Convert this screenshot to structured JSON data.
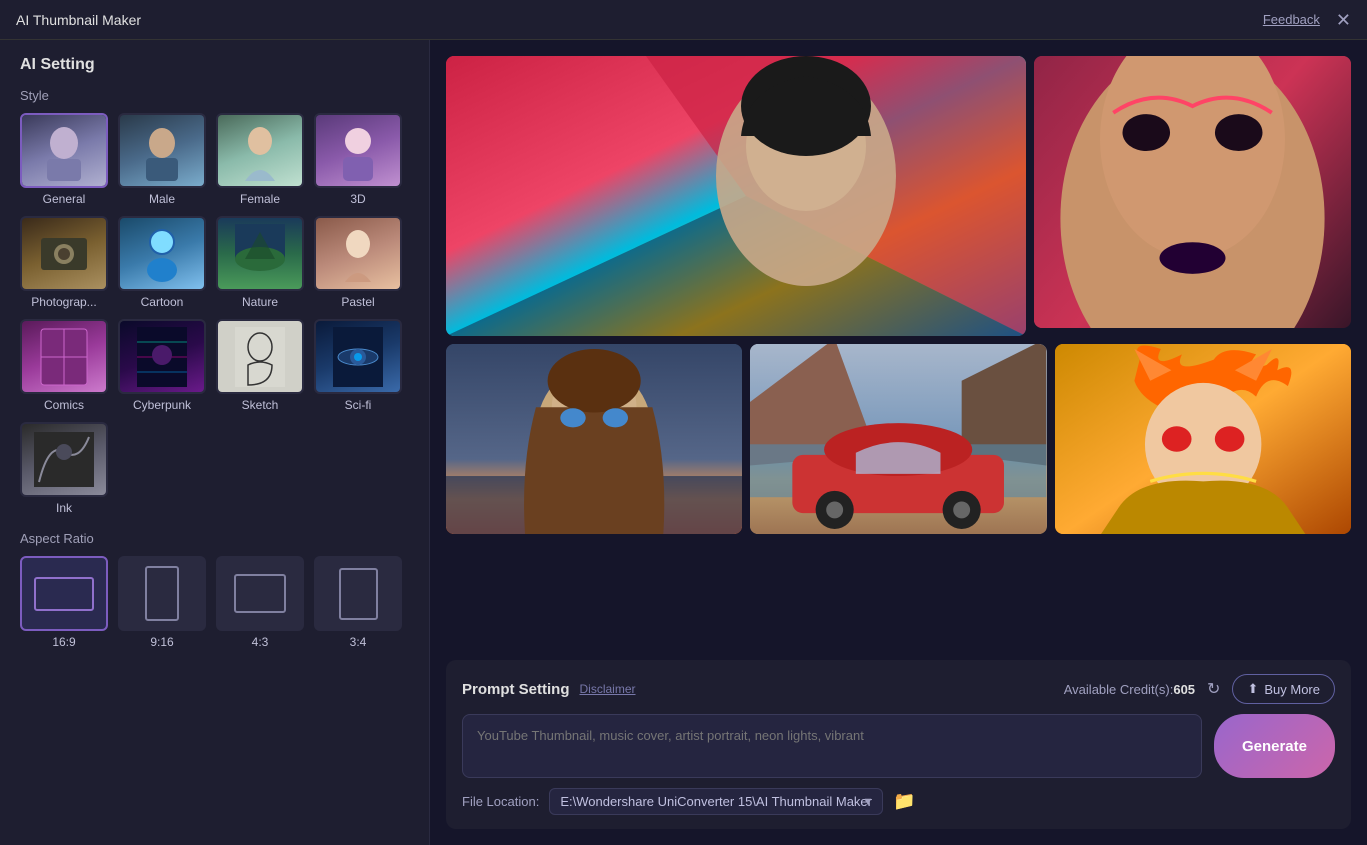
{
  "app": {
    "title": "AI Thumbnail Maker",
    "feedback_label": "Feedback"
  },
  "sidebar": {
    "heading": "AI Setting",
    "style_section_label": "Style",
    "styles": [
      {
        "id": "general",
        "label": "General",
        "selected": true,
        "thumb_class": "thumb-general"
      },
      {
        "id": "male",
        "label": "Male",
        "selected": false,
        "thumb_class": "thumb-male"
      },
      {
        "id": "female",
        "label": "Female",
        "selected": false,
        "thumb_class": "thumb-female"
      },
      {
        "id": "3d",
        "label": "3D",
        "selected": false,
        "thumb_class": "thumb-3d"
      },
      {
        "id": "photograph",
        "label": "Photograp...",
        "selected": false,
        "thumb_class": "thumb-photo"
      },
      {
        "id": "cartoon",
        "label": "Cartoon",
        "selected": false,
        "thumb_class": "thumb-cartoon"
      },
      {
        "id": "nature",
        "label": "Nature",
        "selected": false,
        "thumb_class": "thumb-nature"
      },
      {
        "id": "pastel",
        "label": "Pastel",
        "selected": false,
        "thumb_class": "thumb-pastel"
      },
      {
        "id": "comics",
        "label": "Comics",
        "selected": false,
        "thumb_class": "thumb-comics"
      },
      {
        "id": "cyberpunk",
        "label": "Cyberpunk",
        "selected": false,
        "thumb_class": "thumb-cyberpunk"
      },
      {
        "id": "sketch",
        "label": "Sketch",
        "selected": false,
        "thumb_class": "thumb-sketch"
      },
      {
        "id": "sci-fi",
        "label": "Sci-fi",
        "selected": false,
        "thumb_class": "thumb-sci-fi"
      },
      {
        "id": "ink",
        "label": "Ink",
        "selected": false,
        "thumb_class": "thumb-ink"
      }
    ],
    "aspect_section_label": "Aspect Ratio",
    "aspects": [
      {
        "id": "16-9",
        "label": "16:9",
        "selected": true,
        "shape_class": "aspect-inner-16-9"
      },
      {
        "id": "9-16",
        "label": "9:16",
        "selected": false,
        "shape_class": "aspect-inner-9-16"
      },
      {
        "id": "4-3",
        "label": "4:3",
        "selected": false,
        "shape_class": "aspect-inner-4-3"
      },
      {
        "id": "3-4",
        "label": "3:4",
        "selected": false,
        "shape_class": "aspect-inner-3-4"
      }
    ]
  },
  "prompt": {
    "title": "Prompt Setting",
    "disclaimer_label": "Disclaimer",
    "credits_label": "Available Credit(s):",
    "credits_value": "605",
    "buy_more_label": "Buy More",
    "placeholder": "YouTube Thumbnail, music cover, artist portrait, neon lights, vibrant",
    "generate_label": "Generate"
  },
  "file_location": {
    "label": "File Location:",
    "path": "E:\\Wondershare UniConverter 15\\AI Thumbnail Maker",
    "options": [
      "E:\\Wondershare UniConverter 15\\AI Thumbnail Maker"
    ]
  }
}
